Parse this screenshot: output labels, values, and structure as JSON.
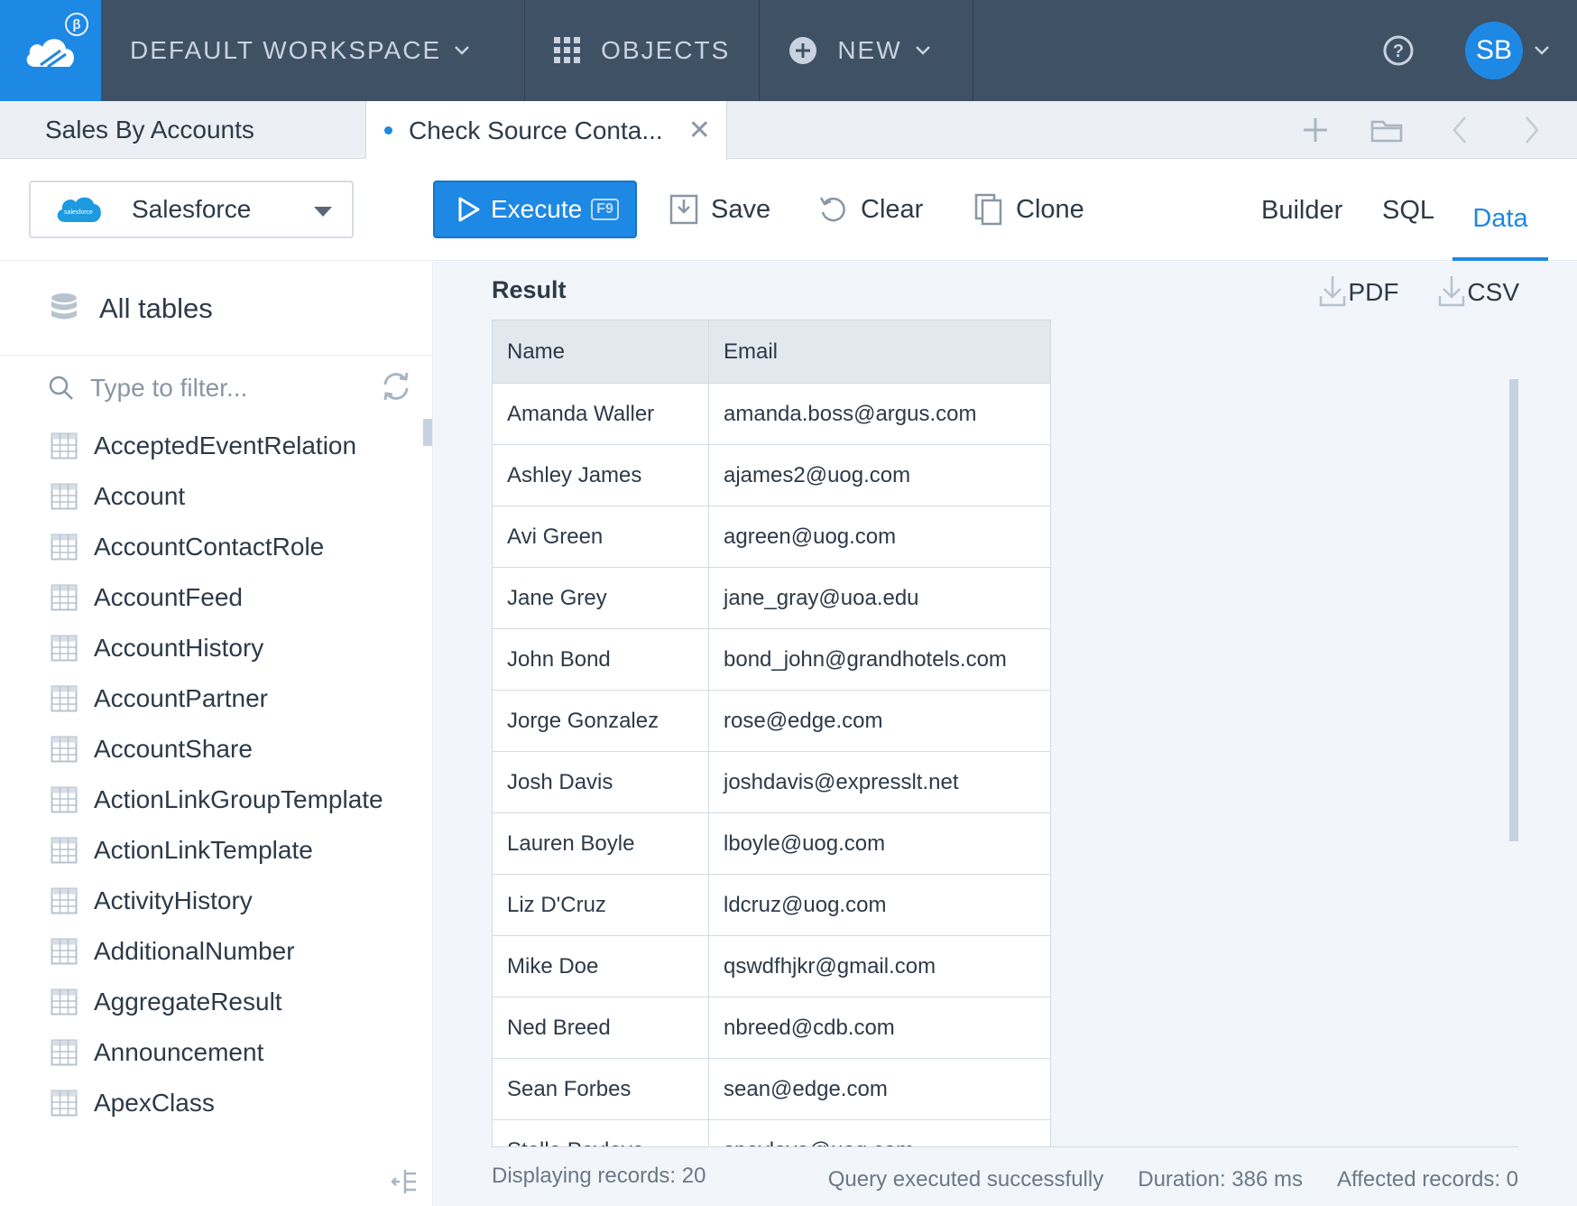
{
  "topbar": {
    "beta_badge": "β",
    "workspace": "DEFAULT WORKSPACE",
    "objects": "OBJECTS",
    "new": "NEW",
    "avatar_initials": "SB"
  },
  "tabs": [
    {
      "label": "Sales By Accounts"
    },
    {
      "label": "Check Source Conta..."
    }
  ],
  "toolbar": {
    "connection": "Salesforce",
    "connection_logo_text": "salesforce",
    "execute_label": "Execute",
    "execute_shortcut": "F9",
    "save_label": "Save",
    "clear_label": "Clear",
    "clone_label": "Clone",
    "view_tabs": [
      "Builder",
      "SQL",
      "Data"
    ],
    "active_view": "Data"
  },
  "sidebar": {
    "title": "All tables",
    "filter_placeholder": "Type to filter...",
    "tables": [
      "AcceptedEventRelation",
      "Account",
      "AccountContactRole",
      "AccountFeed",
      "AccountHistory",
      "AccountPartner",
      "AccountShare",
      "ActionLinkGroupTemplate",
      "ActionLinkTemplate",
      "ActivityHistory",
      "AdditionalNumber",
      "AggregateResult",
      "Announcement",
      "ApexClass"
    ]
  },
  "result": {
    "title": "Result",
    "export_pdf": "PDF",
    "export_csv": "CSV",
    "columns": [
      "Name",
      "Email"
    ],
    "rows": [
      [
        "Amanda Waller",
        "amanda.boss@argus.com"
      ],
      [
        "Ashley James",
        "ajames2@uog.com"
      ],
      [
        "Avi Green",
        "agreen@uog.com"
      ],
      [
        "Jane Grey",
        "jane_gray@uoa.edu"
      ],
      [
        "John Bond",
        "bond_john@grandhotels.com"
      ],
      [
        "Jorge Gonzalez",
        "rose@edge.com"
      ],
      [
        "Josh Davis",
        "joshdavis@expresslt.net"
      ],
      [
        "Lauren Boyle",
        "lboyle@uog.com"
      ],
      [
        "Liz D'Cruz",
        "ldcruz@uog.com"
      ],
      [
        "Mike Doe",
        "qswdfhjkr@gmail.com"
      ],
      [
        "Ned Breed",
        "nbreed@cdb.com"
      ],
      [
        "Sean Forbes",
        "sean@edge.com"
      ],
      [
        "Stella Pavlova",
        "spavlova@uog.com"
      ]
    ]
  },
  "status": {
    "displaying": "Displaying records: 20",
    "message": "Query executed successfully",
    "duration": "Duration: 386 ms",
    "affected": "Affected records: 0"
  },
  "colors": {
    "topbar": "#3f5164",
    "accent": "#1e88e5"
  }
}
